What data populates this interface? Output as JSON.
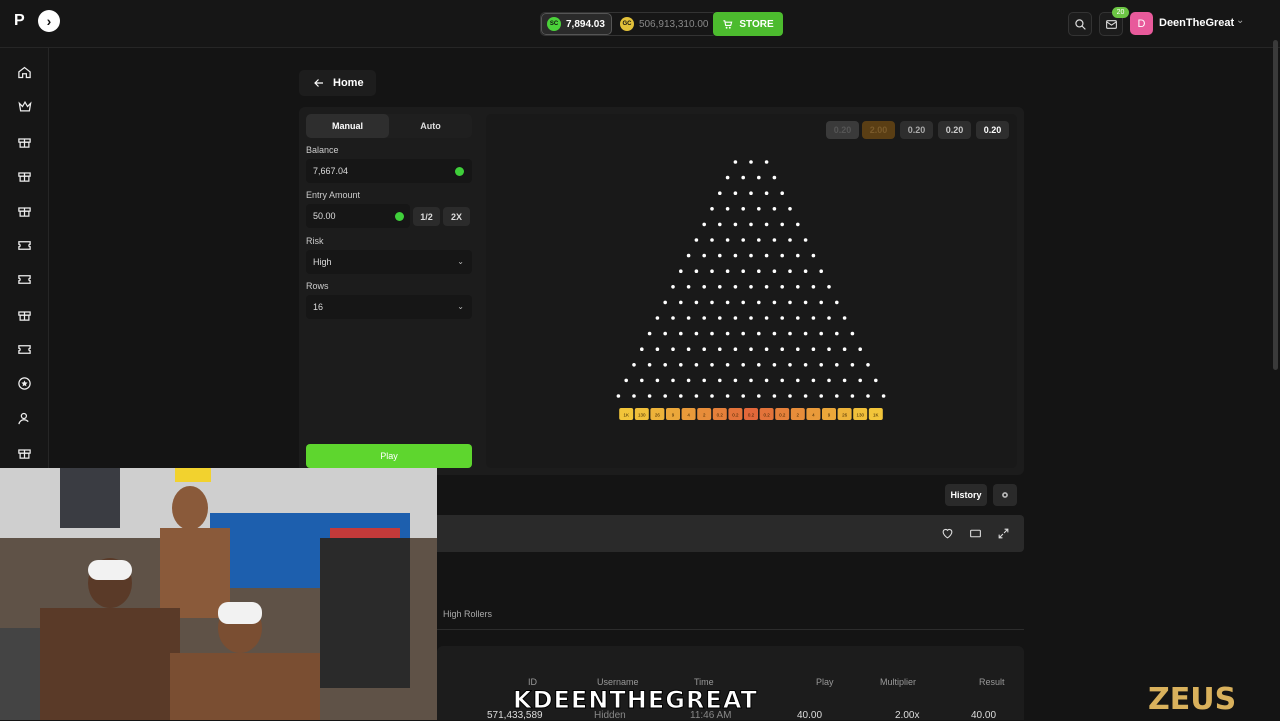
{
  "header": {
    "logo_text": "P",
    "sc_balance": "7,894.03",
    "gc_balance": "506,913,310.00",
    "sc_label": "SC",
    "gc_label": "GC",
    "store_label": "STORE",
    "mail_badge": "20",
    "avatar_letter": "D",
    "username": "DeenTheGreat"
  },
  "sidebar": {
    "icons": [
      "home-icon",
      "crown-icon",
      "gift-icon",
      "gift-icon",
      "gift-icon",
      "ticket-icon",
      "ticket-icon",
      "gift-icon",
      "ticket-icon",
      "star-badge-icon",
      "user-icon",
      "gift-icon"
    ]
  },
  "nav": {
    "home_label": "Home"
  },
  "controls": {
    "tabs": [
      "Manual",
      "Auto"
    ],
    "balance_label": "Balance",
    "balance_value": "7,667.04",
    "entry_label": "Entry Amount",
    "entry_value": "50.00",
    "half_label": "1/2",
    "double_label": "2X",
    "risk_label": "Risk",
    "risk_value": "High",
    "rows_label": "Rows",
    "rows_value": "16",
    "play_label": "Play"
  },
  "recent_results": [
    {
      "value": "0.20",
      "color": "#3a3a3a",
      "text_color": "#555"
    },
    {
      "value": "2.00",
      "color": "#5a3e14",
      "text_color": "#7a5a2a"
    },
    {
      "value": "0.20",
      "color": "#2e2e2e",
      "text_color": "#aaa"
    },
    {
      "value": "0.20",
      "color": "#2e2e2e",
      "text_color": "#ccc"
    },
    {
      "value": "0.20",
      "color": "#2e2e2e",
      "text_color": "#fff"
    }
  ],
  "plinko": {
    "rows": 16,
    "multipliers": [
      "1K",
      "130",
      "26",
      "9",
      "4",
      "2",
      "0.2",
      "0.2",
      "0.2",
      "0.2",
      "0.2",
      "2",
      "4",
      "9",
      "26",
      "130",
      "1K"
    ],
    "bucket_colors": [
      "#f2c53a",
      "#f0bf3a",
      "#edb33a",
      "#eba73a",
      "#e99a3a",
      "#e78d3a",
      "#e5803a",
      "#e3733a",
      "#e3673a",
      "#e3733a",
      "#e5803a",
      "#e78d3a",
      "#e99a3a",
      "#eba73a",
      "#edb33a",
      "#f0bf3a",
      "#f2c53a"
    ]
  },
  "toolbar": {
    "history_label": "History"
  },
  "leaderboard": {
    "tab_label": "High Rollers",
    "columns": [
      "ID",
      "Username",
      "Time",
      "Play",
      "Multiplier",
      "Result"
    ],
    "row": {
      "id": "571,433,589",
      "username": "Hidden",
      "time": "11:46 AM",
      "play": "40.00",
      "multiplier": "2.00x",
      "result": "40.00"
    }
  },
  "stream_overlay": {
    "name": "KDEENTHEGREAT",
    "brand": "ZEUS"
  }
}
